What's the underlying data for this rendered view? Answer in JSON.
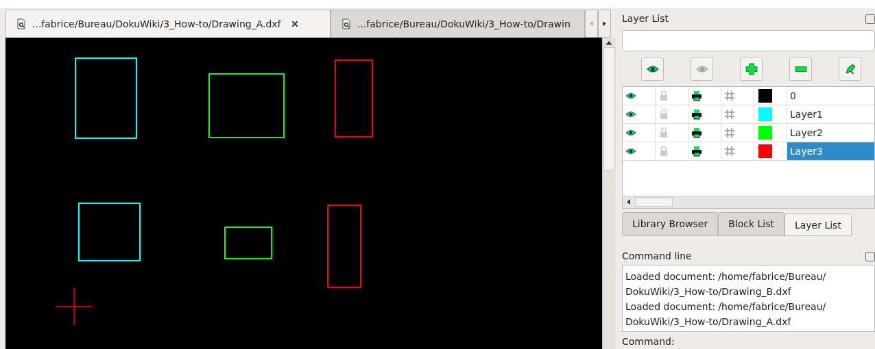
{
  "document_tabs": [
    {
      "label": "...fabrice/Bureau/DokuWiki/3_How-to/Drawing_A.dxf",
      "selected": true,
      "closable": true
    },
    {
      "label": "...fabrice/Bureau/DokuWiki/3_How-to/Drawin",
      "selected": false,
      "closable": false
    }
  ],
  "drawing": {
    "shapes": [
      {
        "kind": "rect",
        "color": "#00ffff"
      },
      {
        "kind": "rect",
        "color": "#00ff00"
      },
      {
        "kind": "rect",
        "color": "#ff0000"
      },
      {
        "kind": "rect",
        "color": "#00ffff"
      },
      {
        "kind": "rect",
        "color": "#00ff00"
      },
      {
        "kind": "rect",
        "color": "#ff0000"
      },
      {
        "kind": "crosshair",
        "color": "#c00000"
      }
    ]
  },
  "layer_panel": {
    "title": "Layer List",
    "toolbar": [
      {
        "kind": "show"
      },
      {
        "kind": "hide"
      },
      {
        "kind": "add"
      },
      {
        "kind": "remove"
      },
      {
        "kind": "edit"
      }
    ],
    "layers": [
      {
        "name": "0",
        "visible": true,
        "locked": false,
        "printable": true,
        "construction": false,
        "color": "#000000",
        "selected": false
      },
      {
        "name": "Layer1",
        "visible": true,
        "locked": false,
        "printable": true,
        "construction": false,
        "color": "#00ffff",
        "selected": false
      },
      {
        "name": "Layer2",
        "visible": true,
        "locked": false,
        "printable": true,
        "construction": false,
        "color": "#00ff00",
        "selected": false
      },
      {
        "name": "Layer3",
        "visible": true,
        "locked": false,
        "printable": true,
        "construction": false,
        "color": "#ff0000",
        "selected": true
      }
    ]
  },
  "dock_tabs": [
    {
      "label": "Library Browser",
      "selected": false
    },
    {
      "label": "Block List",
      "selected": false
    },
    {
      "label": "Layer List",
      "selected": true
    }
  ],
  "command_line": {
    "title": "Command line",
    "history": [
      "Loaded document: /home/fabrice/Bureau/",
      "DokuWiki/3_How-to/Drawing_B.dxf",
      "Loaded document: /home/fabrice/Bureau/",
      "DokuWiki/3_How-to/Drawing_A.dxf"
    ],
    "prompt": "Command:"
  }
}
